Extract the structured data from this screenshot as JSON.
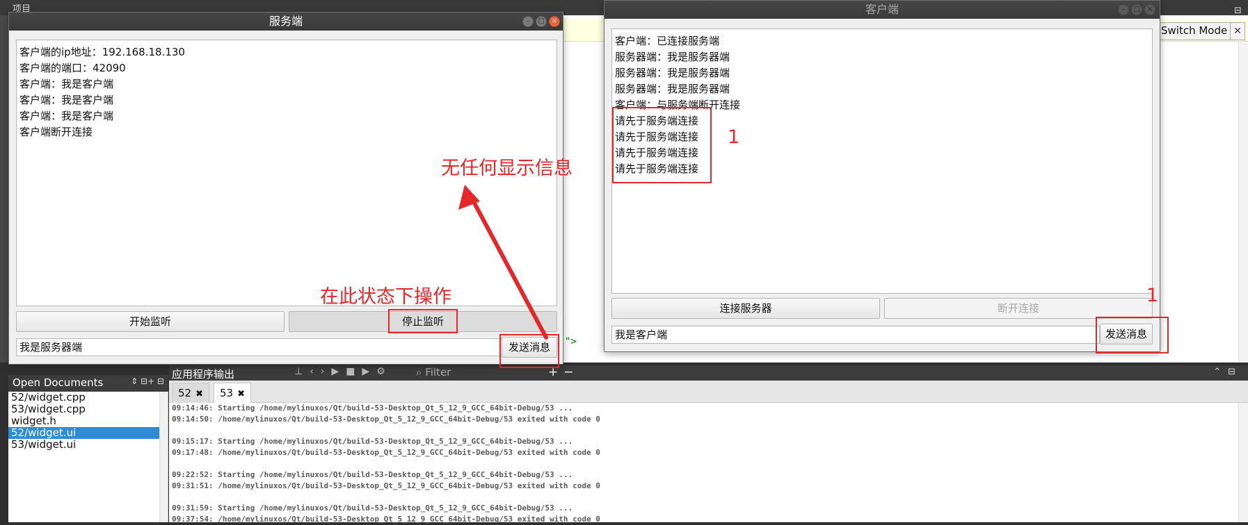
{
  "ide": {
    "switch_mode": "Switch Mode",
    "close_glyph": "✕",
    "top_stub": "项目",
    "editor_snippet": "\">"
  },
  "open_documents": {
    "title": "Open Documents",
    "items": [
      "52/widget.cpp",
      "53/widget.cpp",
      "widget.h",
      "52/widget.ui",
      "53/widget.ui"
    ],
    "selected_index": 3
  },
  "output_panel": {
    "title": "应用程序输出",
    "filter_placeholder": "Filter",
    "tabs": [
      {
        "label": "52"
      },
      {
        "label": "53"
      }
    ],
    "active_tab": 1,
    "log": [
      "09:14:46: Starting /home/mylinuxos/Qt/build-53-Desktop_Qt_5_12_9_GCC_64bit-Debug/53 ...",
      "09:14:50: /home/mylinuxos/Qt/build-53-Desktop_Qt_5_12_9_GCC_64bit-Debug/53 exited with code 0",
      "",
      "09:15:17: Starting /home/mylinuxos/Qt/build-53-Desktop_Qt_5_12_9_GCC_64bit-Debug/53 ...",
      "09:17:48: /home/mylinuxos/Qt/build-53-Desktop_Qt_5_12_9_GCC_64bit-Debug/53 exited with code 0",
      "",
      "09:22:52: Starting /home/mylinuxos/Qt/build-53-Desktop_Qt_5_12_9_GCC_64bit-Debug/53 ...",
      "09:31:51: /home/mylinuxos/Qt/build-53-Desktop_Qt_5_12_9_GCC_64bit-Debug/53 exited with code 0",
      "",
      "09:31:59: Starting /home/mylinuxos/Qt/build-53-Desktop_Qt_5_12_9_GCC_64bit-Debug/53 ...",
      "09:37:54: /home/mylinuxos/Qt/build-53-Desktop_Qt_5_12_9_GCC_64bit-Debug/53 exited with code 0"
    ]
  },
  "server_window": {
    "title": "服务端",
    "log": [
      "客户端的ip地址：192.168.18.130",
      "客户端的端口：42090",
      "客户端：我是客户端",
      "客户端：我是客户端",
      "客户端：我是客户端",
      "客户端断开连接"
    ],
    "start_button": "开始监听",
    "stop_button": "停止监听",
    "input_value": "我是服务器端",
    "send_button": "发送消息"
  },
  "client_window": {
    "title": "客户端",
    "log": [
      "客户端：已连接服务端",
      "服务器端：我是服务器端",
      "服务器端：我是服务器端",
      "服务器端：我是服务器端",
      "客户端：与服务端断开连接",
      "请先于服务端连接",
      "请先于服务端连接",
      "请先于服务端连接",
      "请先于服务端连接"
    ],
    "connect_button": "连接服务器",
    "disconnect_button": "断开连接",
    "input_value": "我是客户端",
    "send_button": "发送消息"
  },
  "annotations": {
    "no_display": "无任何显示信息",
    "operate_here": "在此状态下操作",
    "count_right_box": "1",
    "count_send": "1"
  },
  "colors": {
    "annotation_red": "#e4282a",
    "selection_blue": "#2e8bd6",
    "close_orange": "#e9643a"
  }
}
